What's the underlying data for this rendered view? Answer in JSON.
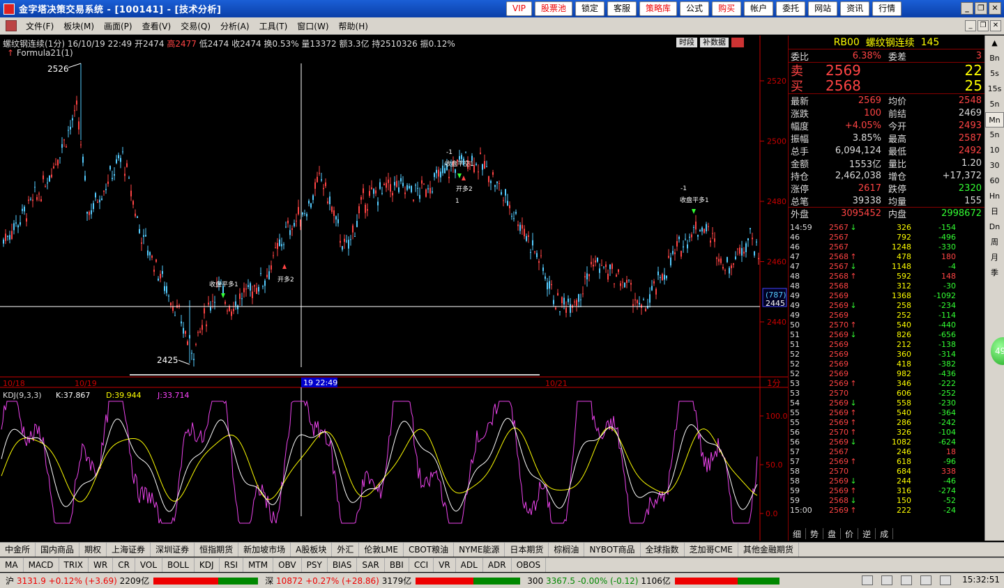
{
  "app": {
    "title": "金字塔决策交易系统 - [100141] - [技术分析]"
  },
  "topbuttons": [
    {
      "label": "VIP",
      "red": true
    },
    {
      "label": "股票池",
      "red": true
    },
    {
      "label": "锁定",
      "red": false
    },
    {
      "label": "客服",
      "red": false
    },
    {
      "label": "策略库",
      "red": true
    },
    {
      "label": "公式",
      "red": false
    },
    {
      "label": "购买",
      "red": true
    },
    {
      "label": "帐户",
      "red": false
    },
    {
      "label": "委托",
      "red": false
    },
    {
      "label": "网站",
      "red": false
    },
    {
      "label": "资讯",
      "red": false
    },
    {
      "label": "行情",
      "red": false
    }
  ],
  "menu": [
    "文件(F)",
    "板块(M)",
    "画面(P)",
    "查看(V)",
    "交易(Q)",
    "分析(A)",
    "工具(T)",
    "窗口(W)",
    "帮助(H)"
  ],
  "chart": {
    "info": {
      "name": "螺纹钢连续",
      "period": "(1分)",
      "date": "16/10/19 22:49",
      "open": "开2474",
      "high": "高2477",
      "low": "低2474",
      "close": "收2474",
      "turnover": "换0.53%",
      "volume": "量13372",
      "amount": "额3.3亿",
      "hold": "持2510326",
      "amp": "振0.12%"
    },
    "formula": "Formula21(1)",
    "buttons": [
      "时段",
      "补数据"
    ],
    "price_ticks": [
      "2520",
      "2500",
      "2480",
      "2460",
      "2440"
    ],
    "cursor_price": "2445",
    "cursor_count": "(787)",
    "dates": [
      "10/18",
      "10/19",
      "10/21"
    ],
    "cursor_time": "19 22:49",
    "period_label": "1分",
    "high_label": "2526",
    "low_label": "2425",
    "signals": [
      {
        "top": "-1",
        "label": "收盘平空1",
        "extra": "开多2",
        "bottom": "1"
      },
      {
        "label": "收盘平多1"
      },
      {
        "label": "开多2"
      },
      {
        "top": "-1",
        "label": "收盘平多1"
      }
    ],
    "kdj": {
      "label": "KDJ(9,3,3)",
      "k": "K:37.867",
      "d": "D:39.944",
      "j": "J:33.714",
      "ticks": [
        "100.0",
        "50.0",
        "0.0"
      ]
    }
  },
  "quote": {
    "code": "RB00",
    "name": "螺纹钢连续",
    "num": "145",
    "weibi": {
      "label": "委比",
      "value": "6.38%",
      "label2": "委差",
      "value2": "3"
    },
    "sell": {
      "label": "卖",
      "price": "2569",
      "qty": "22"
    },
    "buy": {
      "label": "买",
      "price": "2568",
      "qty": "25"
    },
    "rows": [
      {
        "l1": "最新",
        "v1": "2569",
        "c1": "#f44",
        "l2": "均价",
        "v2": "2548",
        "c2": "#f44"
      },
      {
        "l1": "涨跌",
        "v1": "100",
        "c1": "#f44",
        "l2": "前结",
        "v2": "2469",
        "c2": "#ddd"
      },
      {
        "l1": "幅度",
        "v1": "+4.05%",
        "c1": "#f44",
        "l2": "今开",
        "v2": "2493",
        "c2": "#f44"
      },
      {
        "l1": "振幅",
        "v1": "3.85%",
        "c1": "#ddd",
        "l2": "最高",
        "v2": "2587",
        "c2": "#f44"
      },
      {
        "l1": "总手",
        "v1": "6,094,124",
        "c1": "#ddd",
        "l2": "最低",
        "v2": "2492",
        "c2": "#f44"
      },
      {
        "l1": "金额",
        "v1": "1553亿",
        "c1": "#ddd",
        "l2": "量比",
        "v2": "1.20",
        "c2": "#ddd"
      },
      {
        "l1": "持仓",
        "v1": "2,462,038",
        "c1": "#ddd",
        "l2": "增仓",
        "v2": "+17,372",
        "c2": "#ddd"
      },
      {
        "l1": "涨停",
        "v1": "2617",
        "c1": "#f44",
        "l2": "跌停",
        "v2": "2320",
        "c2": "#3f3"
      },
      {
        "l1": "总笔",
        "v1": "39338",
        "c1": "#ddd",
        "l2": "均量",
        "v2": "155",
        "c2": "#ddd"
      },
      {
        "l1": "外盘",
        "v1": "3095452",
        "c1": "#f44",
        "l2": "内盘",
        "v2": "2998672",
        "c2": "#3f3"
      }
    ],
    "ticks": [
      {
        "t": "14:59",
        "p": "2567",
        "a": "↓",
        "v": "326",
        "d": "-154"
      },
      {
        "t": "46",
        "p": "2567",
        "a": "",
        "v": "792",
        "d": "-496"
      },
      {
        "t": "46",
        "p": "2567",
        "a": "",
        "v": "1248",
        "d": "-330"
      },
      {
        "t": "47",
        "p": "2568",
        "a": "↑",
        "v": "478",
        "d": "180"
      },
      {
        "t": "47",
        "p": "2567",
        "a": "↓",
        "v": "1148",
        "d": "-4"
      },
      {
        "t": "48",
        "p": "2568",
        "a": "↑",
        "v": "592",
        "d": "148"
      },
      {
        "t": "48",
        "p": "2568",
        "a": "",
        "v": "312",
        "d": "-30"
      },
      {
        "t": "49",
        "p": "2569",
        "a": "",
        "v": "1368",
        "d": "-1092"
      },
      {
        "t": "49",
        "p": "2569",
        "a": "↓",
        "v": "258",
        "d": "-234"
      },
      {
        "t": "49",
        "p": "2569",
        "a": "",
        "v": "252",
        "d": "-114"
      },
      {
        "t": "50",
        "p": "2570",
        "a": "↑",
        "v": "540",
        "d": "-440"
      },
      {
        "t": "51",
        "p": "2569",
        "a": "↓",
        "v": "826",
        "d": "-656"
      },
      {
        "t": "51",
        "p": "2569",
        "a": "",
        "v": "212",
        "d": "-138"
      },
      {
        "t": "52",
        "p": "2569",
        "a": "",
        "v": "360",
        "d": "-314"
      },
      {
        "t": "52",
        "p": "2569",
        "a": "",
        "v": "418",
        "d": "-382"
      },
      {
        "t": "52",
        "p": "2569",
        "a": "",
        "v": "982",
        "d": "-436"
      },
      {
        "t": "53",
        "p": "2569",
        "a": "↑",
        "v": "346",
        "d": "-222"
      },
      {
        "t": "53",
        "p": "2570",
        "a": "",
        "v": "606",
        "d": "-252"
      },
      {
        "t": "54",
        "p": "2569",
        "a": "↓",
        "v": "558",
        "d": "-230"
      },
      {
        "t": "55",
        "p": "2569",
        "a": "↑",
        "v": "540",
        "d": "-364"
      },
      {
        "t": "55",
        "p": "2569",
        "a": "↑",
        "v": "286",
        "d": "-242"
      },
      {
        "t": "56",
        "p": "2570",
        "a": "↑",
        "v": "326",
        "d": "-104"
      },
      {
        "t": "56",
        "p": "2569",
        "a": "↓",
        "v": "1082",
        "d": "-624"
      },
      {
        "t": "57",
        "p": "2567",
        "a": "",
        "v": "246",
        "d": "18"
      },
      {
        "t": "57",
        "p": "2569",
        "a": "↑",
        "v": "618",
        "d": "-96"
      },
      {
        "t": "58",
        "p": "2570",
        "a": "",
        "v": "684",
        "d": "338"
      },
      {
        "t": "58",
        "p": "2569",
        "a": "↓",
        "v": "244",
        "d": "-46"
      },
      {
        "t": "59",
        "p": "2569",
        "a": "↑",
        "v": "316",
        "d": "-274"
      },
      {
        "t": "59",
        "p": "2568",
        "a": "↓",
        "v": "150",
        "d": "-52"
      },
      {
        "t": "15:00",
        "p": "2569",
        "a": "↑",
        "v": "222",
        "d": "-24"
      }
    ],
    "tabs": [
      "细",
      "势",
      "盘",
      "价",
      "逆",
      "成"
    ]
  },
  "sidebar": [
    "Bn",
    "5s",
    "15s",
    "5n",
    "Mn",
    "5n",
    "10",
    "30",
    "60",
    "Hn",
    "日",
    "Dn",
    "周",
    "月",
    "季"
  ],
  "greenball": "49",
  "markets": [
    "中金所",
    "国内商品",
    "期权",
    "上海证券",
    "深圳证券",
    "恒指期货",
    "新加坡市场",
    "A股板块",
    "外汇",
    "伦敦LME",
    "CBOT粮油",
    "NYME能源",
    "日本期货",
    "棕榈油",
    "NYBOT商品",
    "全球指数",
    "芝加哥CME",
    "其他金融期货"
  ],
  "indicators": [
    "MA",
    "MACD",
    "TRIX",
    "WR",
    "CR",
    "VOL",
    "BOLL",
    "KDJ",
    "RSI",
    "MTM",
    "OBV",
    "PSY",
    "BIAS",
    "SAR",
    "BBI",
    "CCI",
    "VR",
    "ADL",
    "ADR",
    "OBOS"
  ],
  "status": {
    "sh": {
      "label": "沪",
      "value": "3131.9",
      "pct": "+0.12%",
      "chg": "(+3.69)",
      "amt": "2209亿",
      "ratio": 0.62
    },
    "sz": {
      "label": "深",
      "value": "10872",
      "pct": "+0.27%",
      "chg": "(+28.86)",
      "amt": "3179亿",
      "ratio": 0.55
    },
    "hs": {
      "label": "300",
      "value": "3367.5",
      "pct": "-0.00%",
      "chg": "(-0.12)",
      "amt": "1106亿",
      "ratio": 0.6
    },
    "time": "15:32:51"
  }
}
